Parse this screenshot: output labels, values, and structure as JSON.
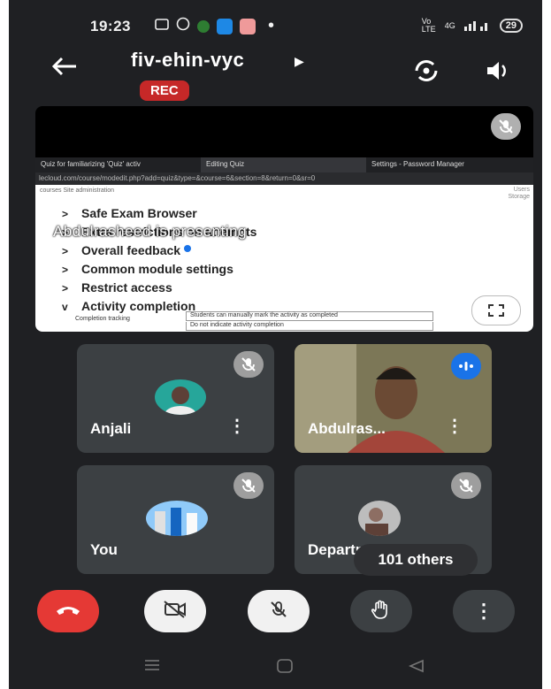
{
  "status_bar": {
    "time": "19:23",
    "network": "Vo LTE",
    "signal": "4G",
    "battery": "29"
  },
  "header": {
    "meeting_code": "fiv-ehin-vyc",
    "rec_label": "REC"
  },
  "presentation": {
    "browser_tabs": [
      "Quiz for familiarizing 'Quiz' activ",
      "Editing Quiz",
      "Settings - Password Manager"
    ],
    "url": "lecloud.com/course/modedit.php?add=quiz&type=&course=6&section=8&return=0&sr=0",
    "breadcrumb": "courses  Site administration",
    "right_links": [
      "Users",
      "Storage"
    ],
    "settings": [
      {
        "chevron": ">",
        "label": "Safe Exam Browser"
      },
      {
        "chevron": ">",
        "label": "Extra restrictions on attempts"
      },
      {
        "chevron": ">",
        "label": "Overall feedback"
      },
      {
        "chevron": ">",
        "label": "Common module settings"
      },
      {
        "chevron": ">",
        "label": "Restrict access"
      },
      {
        "chevron": "v",
        "label": "Activity completion"
      }
    ],
    "presenting_text": "Abdulrasheed is presenting",
    "completion_tracking_label": "Completion tracking",
    "select_value": "Students can manually mark the activity as completed",
    "dropdown_option": "Do not indicate activity completion"
  },
  "participants": [
    {
      "name": "Anjali",
      "muted": true
    },
    {
      "name": "Abdulras...",
      "speaking": true
    },
    {
      "name": "You",
      "muted": true
    },
    {
      "name": "Department of E...",
      "muted": true
    }
  ],
  "others_label": "101 others",
  "colors": {
    "background": "#1f2023",
    "tile": "#3c4043",
    "rec": "#c62828",
    "end_call": "#e53935",
    "speaking_badge": "#1a73e8"
  }
}
